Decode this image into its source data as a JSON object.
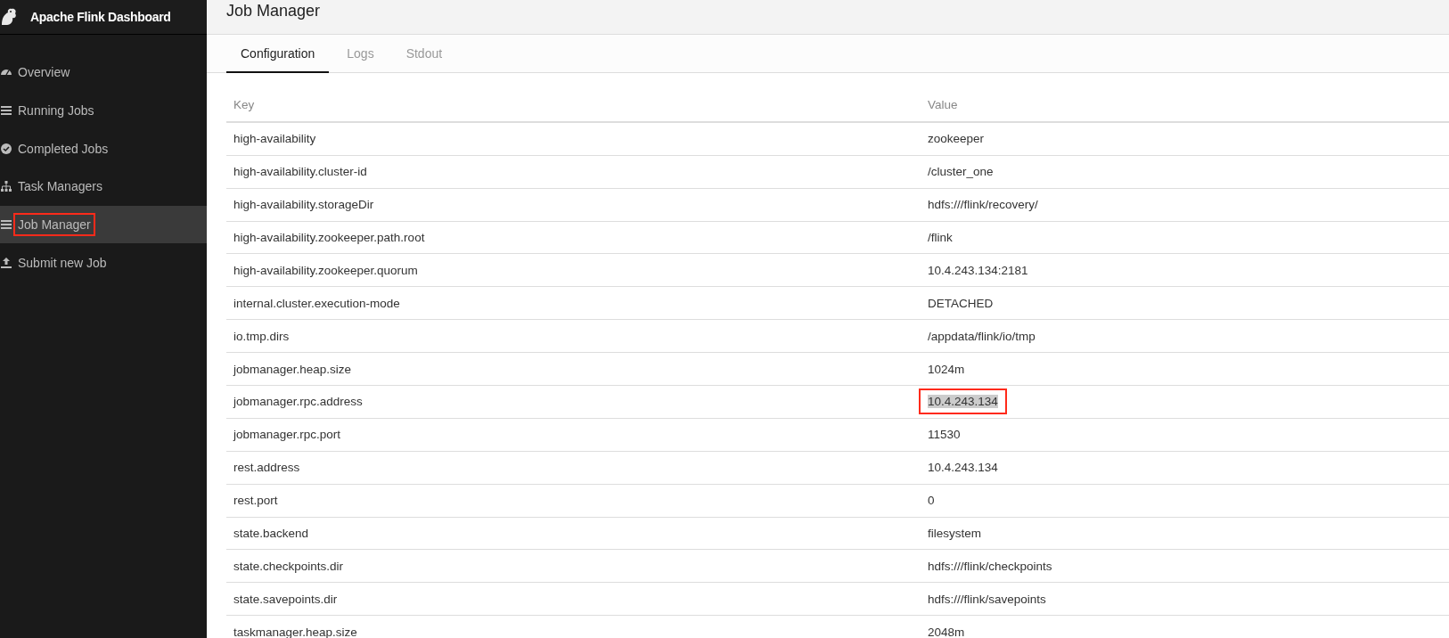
{
  "sidebar": {
    "brand": "Apache Flink Dashboard",
    "items": [
      {
        "label": "Overview",
        "selected": false,
        "annotated": false
      },
      {
        "label": "Running Jobs",
        "selected": false,
        "annotated": false
      },
      {
        "label": "Completed Jobs",
        "selected": false,
        "annotated": false
      },
      {
        "label": "Task Managers",
        "selected": false,
        "annotated": false
      },
      {
        "label": "Job Manager",
        "selected": true,
        "annotated": true
      },
      {
        "label": "Submit new Job",
        "selected": false,
        "annotated": false
      }
    ]
  },
  "page": {
    "title": "Job Manager"
  },
  "tabs": [
    {
      "label": "Configuration",
      "selected": true
    },
    {
      "label": "Logs",
      "selected": false
    },
    {
      "label": "Stdout",
      "selected": false
    }
  ],
  "table": {
    "columns": [
      "Key",
      "Value"
    ],
    "rows": [
      {
        "key": "high-availability",
        "value": "zookeeper",
        "annotated": false
      },
      {
        "key": "high-availability.cluster-id",
        "value": "/cluster_one",
        "annotated": false
      },
      {
        "key": "high-availability.storageDir",
        "value": "hdfs:///flink/recovery/",
        "annotated": false
      },
      {
        "key": "high-availability.zookeeper.path.root",
        "value": "/flink",
        "annotated": false
      },
      {
        "key": "high-availability.zookeeper.quorum",
        "value": "10.4.243.134:2181",
        "annotated": false
      },
      {
        "key": "internal.cluster.execution-mode",
        "value": "DETACHED",
        "annotated": false
      },
      {
        "key": "io.tmp.dirs",
        "value": "/appdata/flink/io/tmp",
        "annotated": false
      },
      {
        "key": "jobmanager.heap.size",
        "value": "1024m",
        "annotated": false
      },
      {
        "key": "jobmanager.rpc.address",
        "value": "10.4.243.134",
        "annotated": true
      },
      {
        "key": "jobmanager.rpc.port",
        "value": "11530",
        "annotated": false
      },
      {
        "key": "rest.address",
        "value": "10.4.243.134",
        "annotated": false
      },
      {
        "key": "rest.port",
        "value": "0",
        "annotated": false
      },
      {
        "key": "state.backend",
        "value": "filesystem",
        "annotated": false
      },
      {
        "key": "state.checkpoints.dir",
        "value": "hdfs:///flink/checkpoints",
        "annotated": false
      },
      {
        "key": "state.savepoints.dir",
        "value": "hdfs:///flink/savepoints",
        "annotated": false
      },
      {
        "key": "taskmanager.heap.size",
        "value": "2048m",
        "annotated": false
      }
    ]
  }
}
